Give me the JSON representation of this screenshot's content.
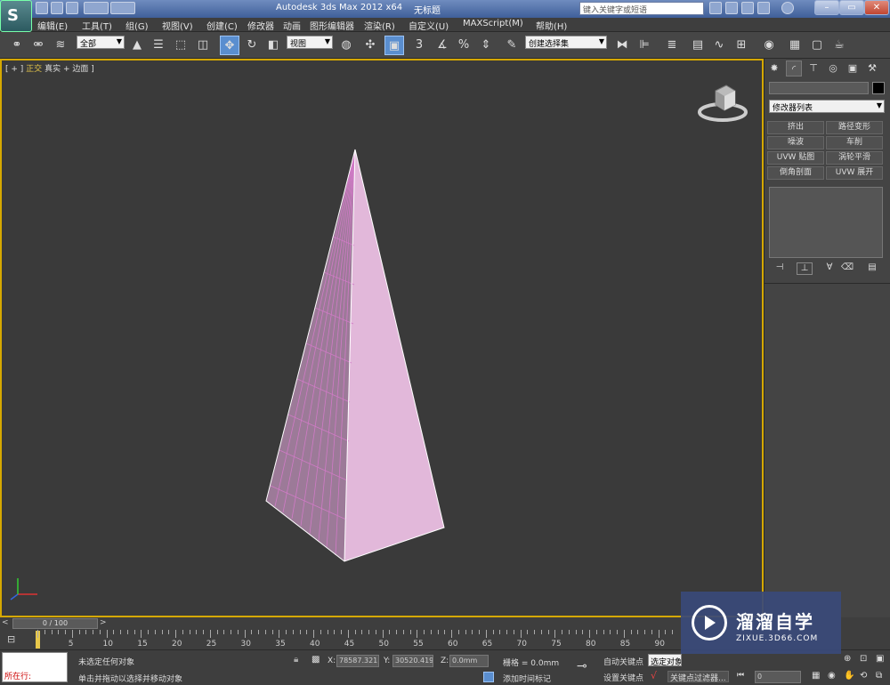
{
  "titlebar": {
    "app_title": "Autodesk 3ds Max  2012 x64",
    "document_title": "无标题",
    "search_placeholder": "键入关键字或短语",
    "colors": {
      "bar": "#4f6ea8",
      "accent": "#d5a800"
    }
  },
  "menu": {
    "items": [
      "编辑(E)",
      "工具(T)",
      "组(G)",
      "视图(V)",
      "创建(C)",
      "修改器",
      "动画",
      "图形编辑器",
      "渲染(R)",
      "自定义(U)",
      "MAXScript(M)",
      "帮助(H)"
    ]
  },
  "toolbar": {
    "selection_filter": "全部",
    "reference_coord": "视图",
    "named_selection_placeholder": "创建选择集",
    "snap_label": "3"
  },
  "viewport": {
    "label_open": "[ + ]",
    "label_view": "正交",
    "label_shading": "真实",
    "label_edges": "边面",
    "label_close": "]",
    "object": {
      "type": "pyramid",
      "color": "#e2b8da",
      "grid_color": "#d07bc6"
    }
  },
  "command_panel": {
    "tabs": [
      "create-icon",
      "modify-icon",
      "hierarchy-icon",
      "motion-icon",
      "display-icon",
      "utilities-icon"
    ],
    "modifier_list": "修改器列表",
    "modifier_buttons": [
      "挤出",
      "路径变形",
      "噪波",
      "车削",
      "UVW 贴图",
      "涡轮平滑",
      "倒角剖面",
      "UVW 展开"
    ],
    "object_color": "#000000"
  },
  "timeline": {
    "slider_label": "0 / 100",
    "frames": [
      "0",
      "5",
      "10",
      "15",
      "20",
      "25",
      "30",
      "35",
      "40",
      "45",
      "50",
      "55",
      "60",
      "65",
      "70",
      "75",
      "80",
      "85",
      "90"
    ]
  },
  "status": {
    "maxscript_line": "所在行:",
    "selection_status": "未选定任何对象",
    "prompt": "单击并拖动以选择并移动对象",
    "x_label": "X:",
    "x_value": "78587.321",
    "y_label": "Y:",
    "y_value": "30520.419",
    "z_label": "Z:",
    "z_value": "0.0mm",
    "grid": "栅格 = 0.0mm",
    "add_time_tag": "添加时间标记",
    "auto_key": "自动关键点",
    "set_key": "设置关键点",
    "selected_mode": "选定对象",
    "key_filters": "关键点过滤器...",
    "frame_value": "0"
  },
  "watermark": {
    "brand": "溜溜自学",
    "url": "ZIXUE.3D66.COM"
  }
}
